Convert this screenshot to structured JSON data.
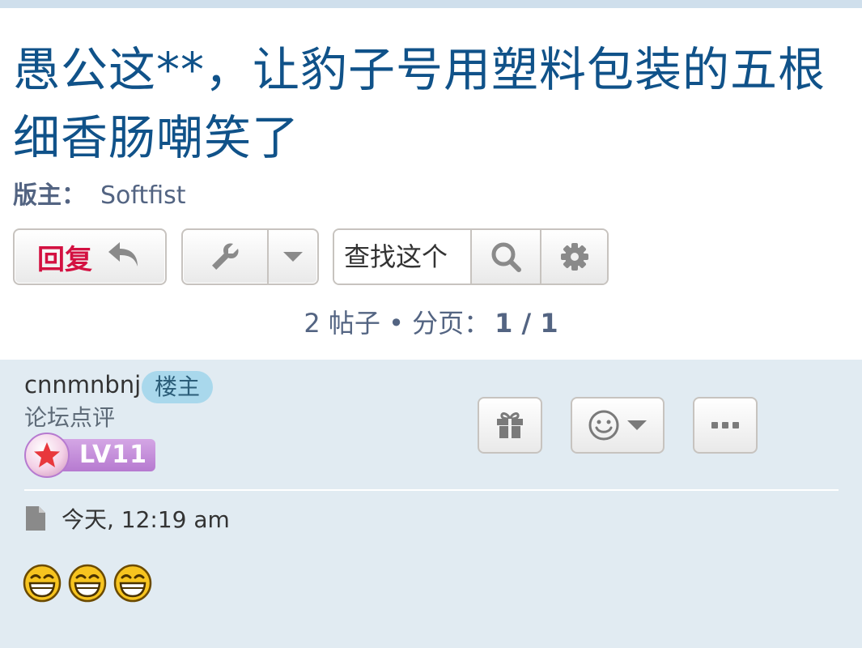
{
  "topic": {
    "title": "愚公这**，让豹子号用塑料包装的五根细香肠嘲笑了",
    "moderator_label": "版主：",
    "moderator_name": "Softfist"
  },
  "toolbar": {
    "reply_label": "回复",
    "search_placeholder": "查找这个",
    "icons": [
      "reply-arrow-icon",
      "wrench-icon",
      "caret-down-icon",
      "search-icon",
      "gear-icon"
    ]
  },
  "pagination": {
    "summary": "2 帖子 • 分页：",
    "pages": "1 / 1"
  },
  "post": {
    "author": "cnnmnbnj",
    "op_badge": "楼主",
    "rank": "论坛点评",
    "level": "LV11",
    "time": "今天, 12:19 am",
    "smiley_count": 3
  },
  "colors": {
    "title": "#105289",
    "reply_red": "#d31141",
    "post_bg": "#e1ebf2",
    "op_badge_bg": "#a9d8ec",
    "level_purple": "#b67ad0"
  }
}
